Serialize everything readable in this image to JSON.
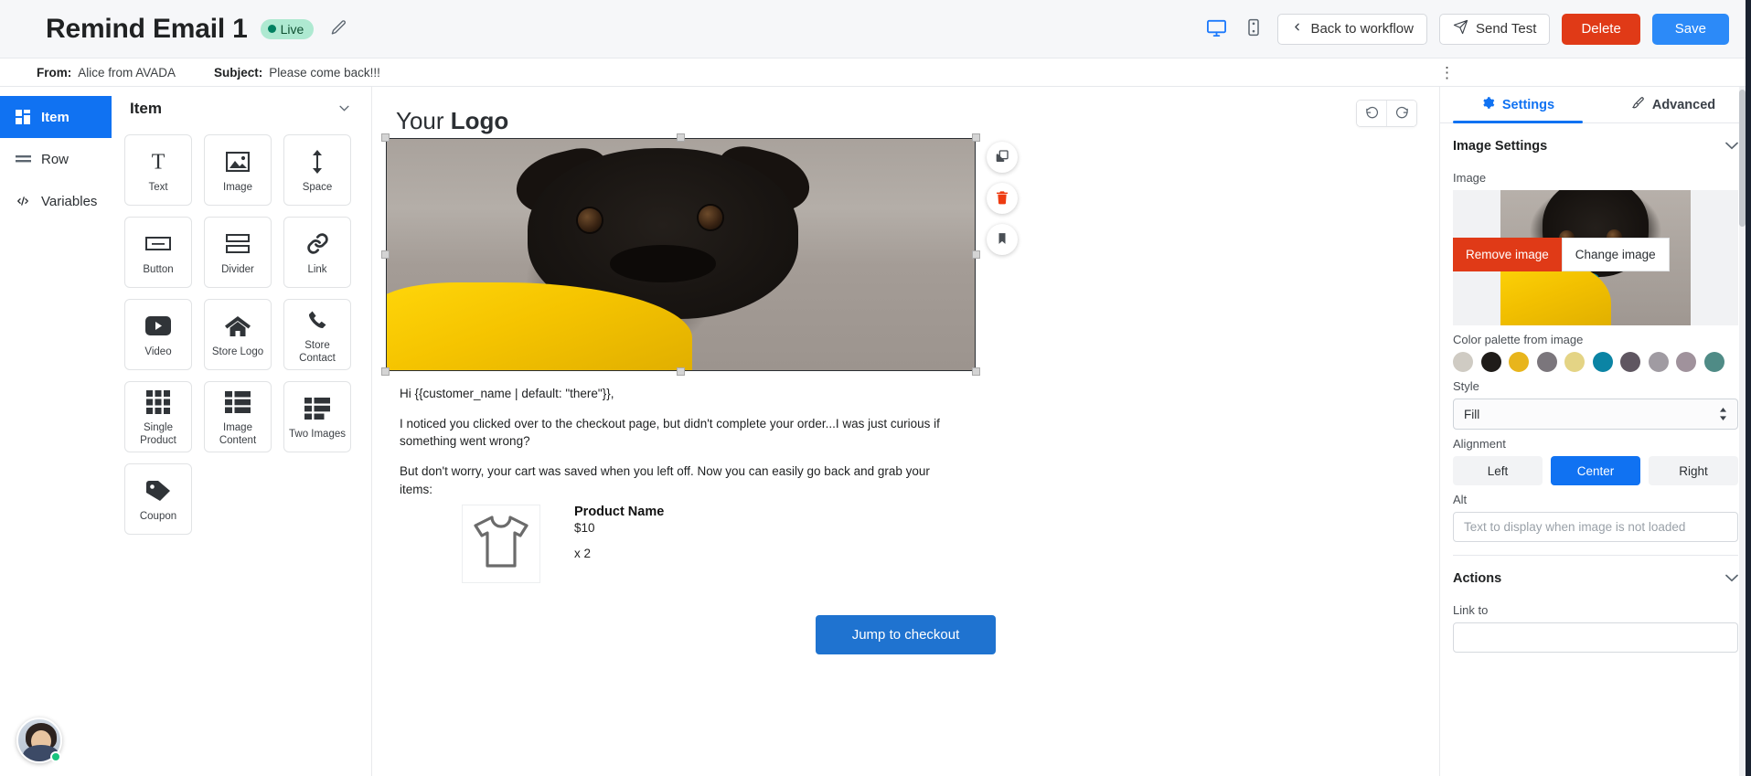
{
  "topbar": {
    "title": "Remind Email 1",
    "status_badge": "Live",
    "edit_icon": "pencil-icon",
    "desktop_icon": "desktop-preview-icon",
    "mobile_icon": "mobile-preview-icon",
    "back_label": "Back to workflow",
    "send_test_label": "Send Test",
    "delete_label": "Delete",
    "save_label": "Save",
    "accent_blue": "#2c8af8",
    "danger_red": "#e03a17",
    "live_green": "#008060"
  },
  "subjectbar": {
    "from_label": "From:",
    "from_value": "Alice from AVADA",
    "subject_label": "Subject:",
    "subject_value": "Please come back!!!",
    "kebab": "⋮"
  },
  "rail": {
    "items": [
      {
        "label": "Item",
        "icon": "grid-icon",
        "active": true
      },
      {
        "label": "Row",
        "icon": "rows-icon",
        "active": false
      },
      {
        "label": "Variables",
        "icon": "code-icon",
        "active": false
      }
    ]
  },
  "items_panel": {
    "title": "Item",
    "collapse_icon": "chevron-down-icon",
    "tiles": [
      {
        "label": "Text",
        "icon": "text-icon"
      },
      {
        "label": "Image",
        "icon": "image-icon"
      },
      {
        "label": "Space",
        "icon": "space-arrow-icon"
      },
      {
        "label": "Button",
        "icon": "button-icon"
      },
      {
        "label": "Divider",
        "icon": "divider-icon"
      },
      {
        "label": "Link",
        "icon": "link-icon"
      },
      {
        "label": "Video",
        "icon": "video-play-icon"
      },
      {
        "label": "Store Logo",
        "icon": "home-icon"
      },
      {
        "label": "Store Contact",
        "icon": "phone-icon"
      },
      {
        "label": "Single Product",
        "icon": "grid-nine-icon"
      },
      {
        "label": "Image Content",
        "icon": "image-content-icon"
      },
      {
        "label": "Two Images",
        "icon": "two-images-icon"
      },
      {
        "label": "Coupon",
        "icon": "coupon-tag-icon"
      }
    ]
  },
  "canvas": {
    "undo_icon": "undo-icon",
    "redo_icon": "redo-icon",
    "logo_text_prefix": "Your ",
    "logo_text_bold": "Logo",
    "float_tools": [
      {
        "name": "duplicate-icon",
        "label": "Duplicate"
      },
      {
        "name": "trash-icon",
        "label": "Delete"
      },
      {
        "name": "bookmark-icon",
        "label": "Save block"
      }
    ],
    "body_paragraphs": [
      "Hi {{customer_name | default: \"there\"}},",
      "I noticed you clicked over to the checkout page, but didn't complete your order...I was just curious if something went wrong?",
      "But don't worry, your cart was saved when you left off. Now you can easily go back and grab your items:"
    ],
    "product": {
      "thumb_icon": "tshirt-icon",
      "name": "Product Name",
      "price": "$10",
      "quantity": "x 2"
    },
    "cta_label": "Jump to checkout",
    "cta_color": "#1f73d0"
  },
  "settings": {
    "tabs": [
      {
        "label": "Settings",
        "icon": "gear-icon",
        "active": true
      },
      {
        "label": "Advanced",
        "icon": "brush-icon",
        "active": false
      }
    ],
    "image_settings": {
      "section_title": "Image Settings",
      "image_label": "Image",
      "remove_label": "Remove image",
      "change_label": "Change image",
      "palette_label": "Color palette from image",
      "palette": [
        "#cfcbc3",
        "#1f1c19",
        "#e8b51c",
        "#7b767c",
        "#e4d485",
        "#0b84a4",
        "#5f5661",
        "#a09ba2",
        "#a0929c",
        "#4f8b86"
      ],
      "style_label": "Style",
      "style_value": "Fill",
      "alignment_label": "Alignment",
      "alignment_options": [
        "Left",
        "Center",
        "Right"
      ],
      "alignment_selected": "Center",
      "alt_label": "Alt",
      "alt_value": "",
      "alt_placeholder": "Text to display when image is not loaded"
    },
    "actions": {
      "section_title": "Actions",
      "link_to_label": "Link to"
    }
  }
}
